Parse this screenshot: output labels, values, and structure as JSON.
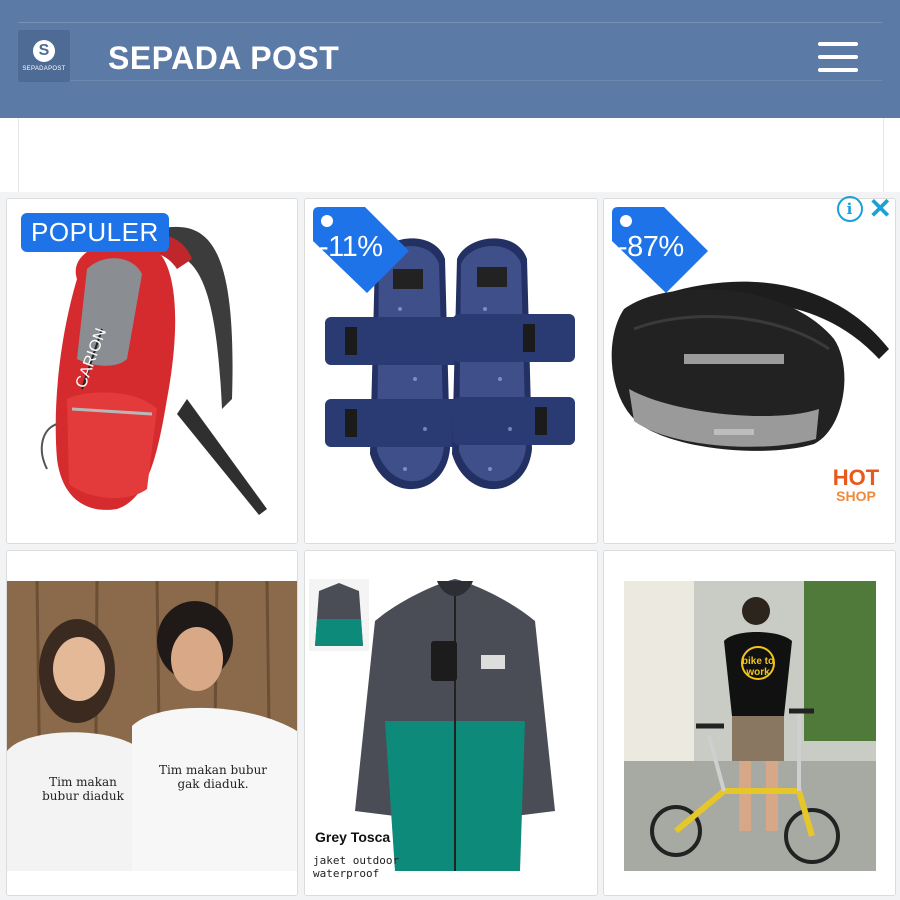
{
  "header": {
    "site_title": "SEPADA POST",
    "logo_letter": "S",
    "logo_caption": "SEPADAPOST",
    "background_color": "#5b7aa5",
    "menu_icon": "hamburger-menu-icon"
  },
  "ad": {
    "choices_info_icon": "info-icon",
    "choices_close_icon": "close-icon",
    "accent_color": "#1aa1d9",
    "products": [
      {
        "kind": "backpack",
        "badge": "POPULER",
        "brand": "CARION"
      },
      {
        "kind": "sandals",
        "discount": "-11%"
      },
      {
        "kind": "waist-bag",
        "discount": "-87%",
        "shop_logo_top": "HOT",
        "shop_logo_bottom": "SHOP"
      },
      {
        "kind": "couple-tshirts",
        "shirt_text_left": "Tim makan bubur diaduk",
        "shirt_text_right": "Tim makan bubur gak diaduk."
      },
      {
        "kind": "jacket",
        "caption_title": "Grey Tosca",
        "caption_sub": "jaket outdoor waterproof"
      },
      {
        "kind": "folding-bike",
        "shirt_text": "bike to work"
      }
    ]
  }
}
